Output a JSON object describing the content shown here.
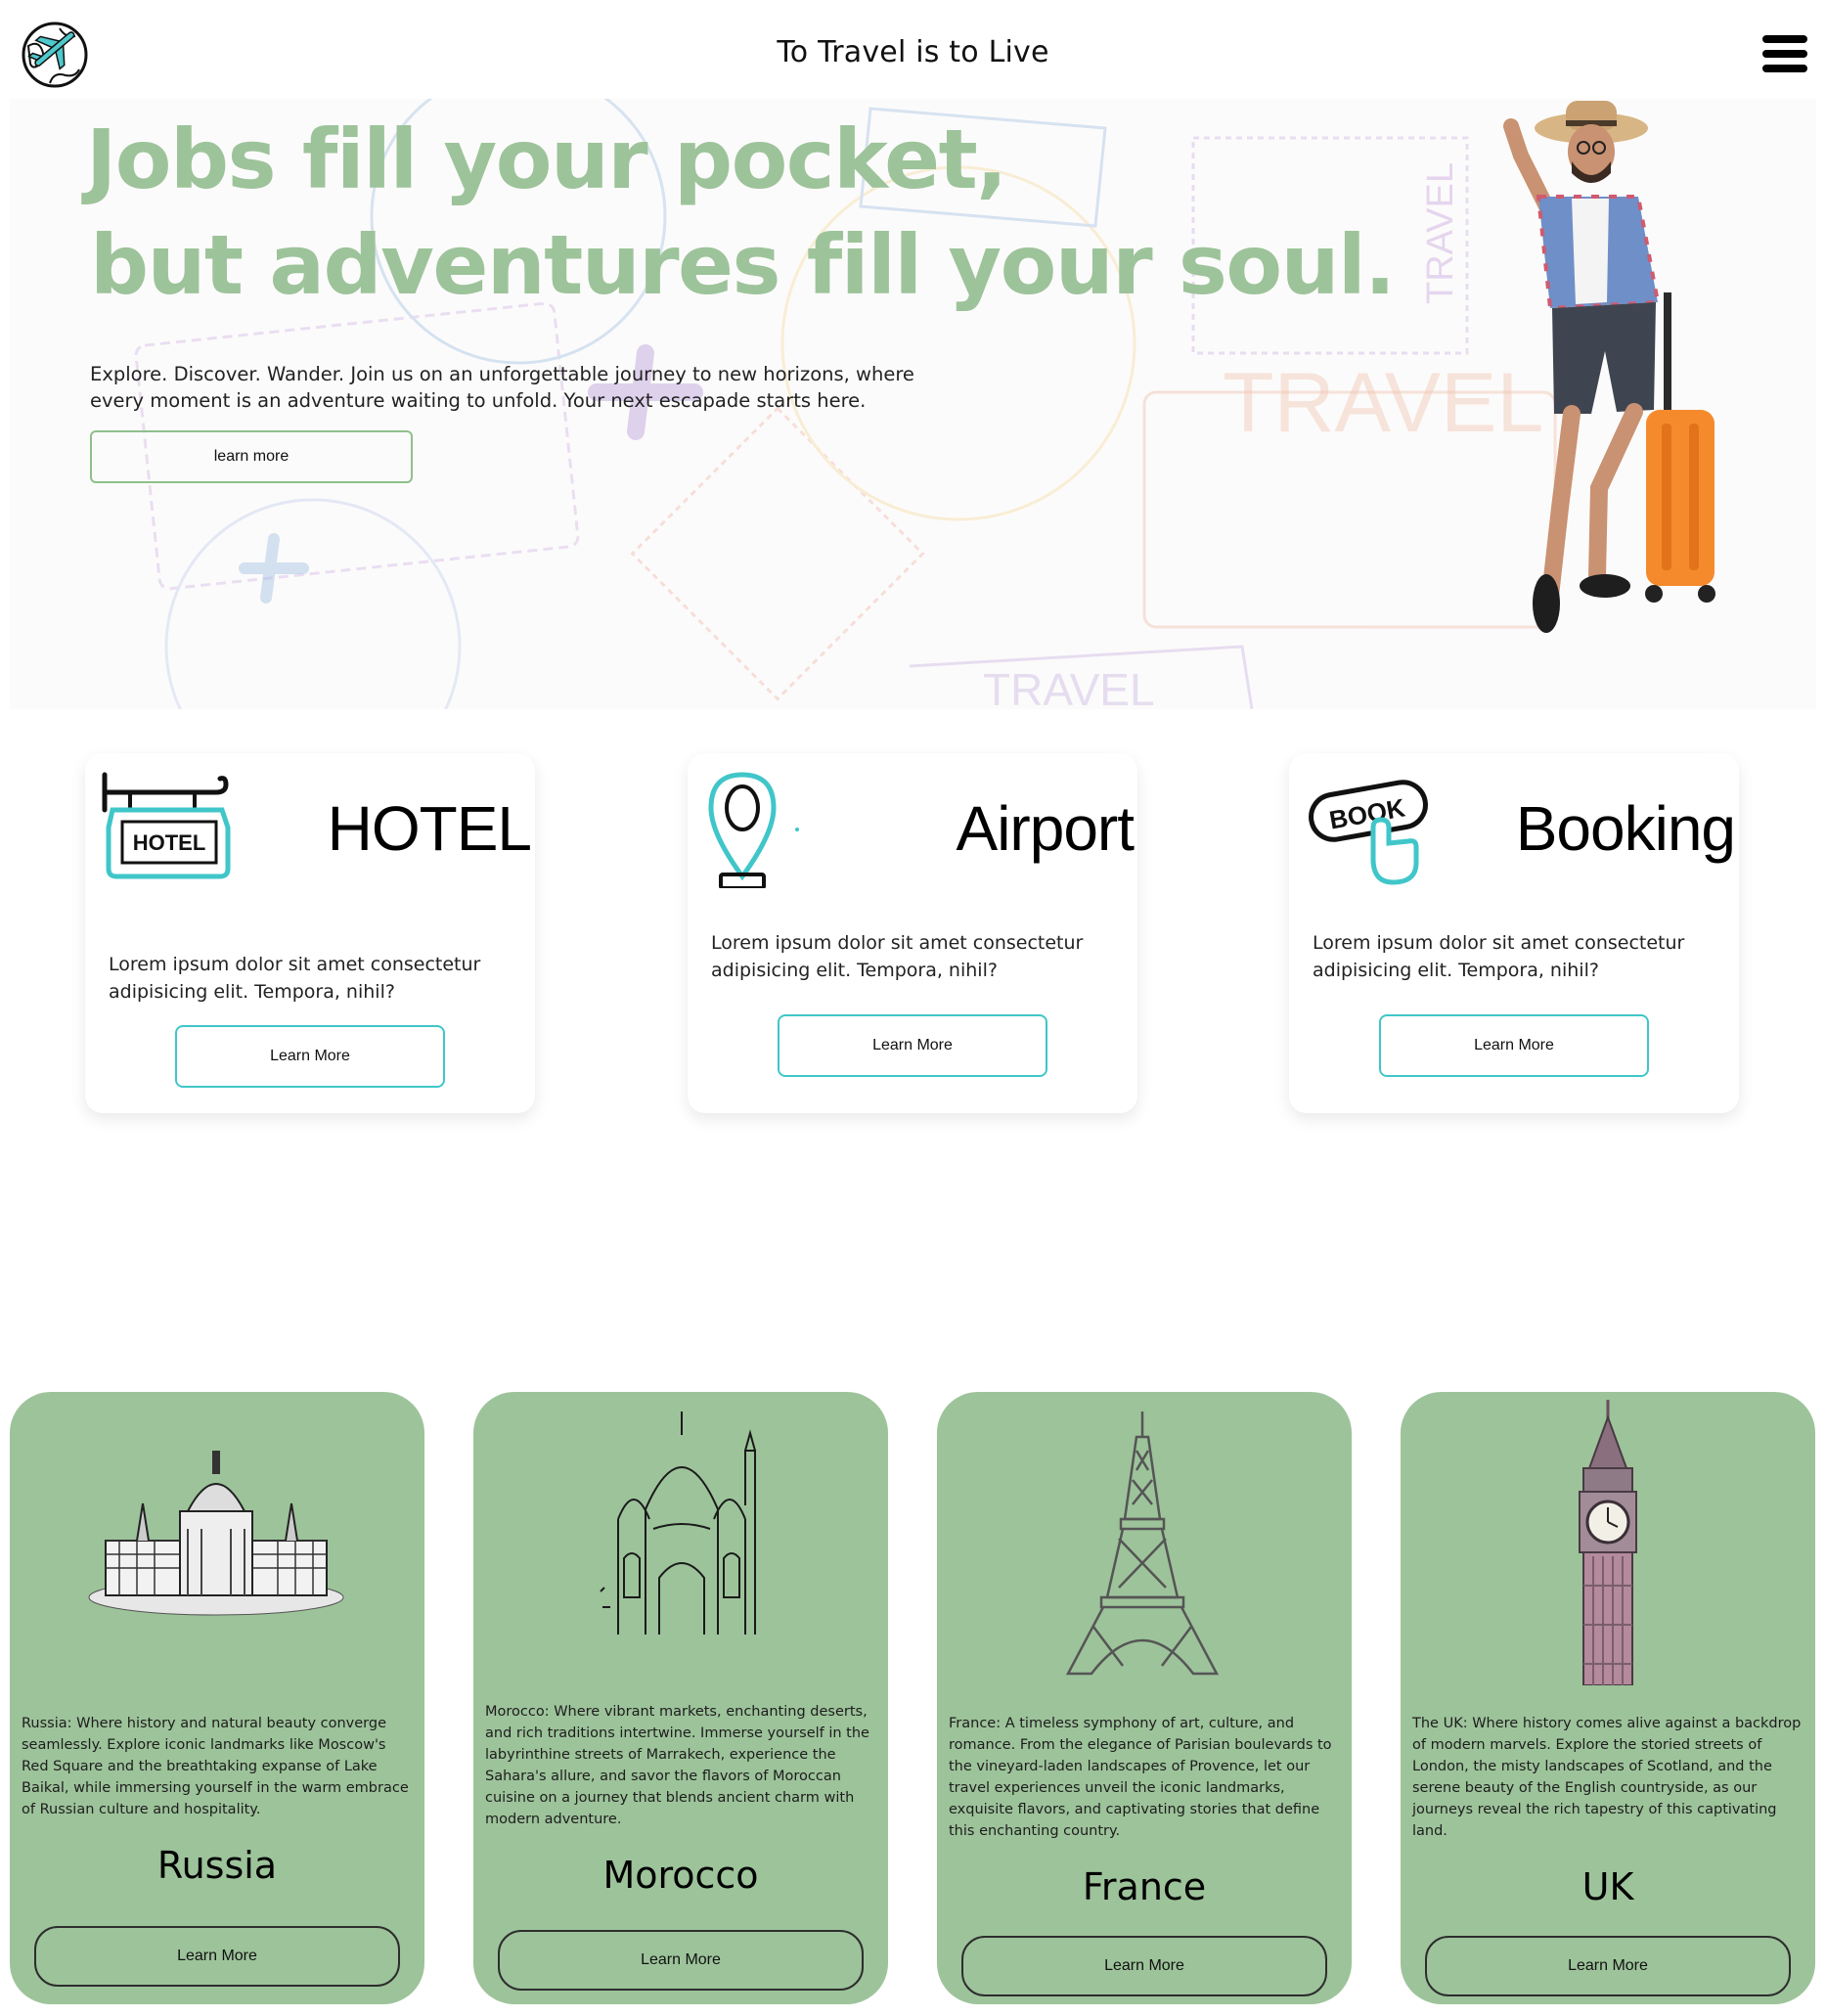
{
  "header": {
    "title": "To Travel is to Live",
    "logo_icon": "globe-plane-icon",
    "menu_icon": "hamburger-menu-icon"
  },
  "hero": {
    "title_line1": "Jobs fill your pocket,",
    "title_line2": "but adventures fill your soul.",
    "description": "Explore. Discover. Wander. Join us on an unforgettable journey to new horizons, where every moment is an adventure waiting to unfold. Your next escapade starts here.",
    "button_label": "learn more",
    "background_stamp_text": "TRAVEL",
    "accent_color": "#9dc39a"
  },
  "services": [
    {
      "title": "HOTEL",
      "icon": "hotel-sign-icon",
      "sign_text": "HOTEL",
      "text": "Lorem ipsum dolor sit amet consectetur adipisicing elit. Tempora, nihil?",
      "button_label": "Learn More"
    },
    {
      "title": "Airport",
      "icon": "location-pin-icon",
      "text": "Lorem ipsum dolor sit amet consectetur adipisicing elit. Tempora, nihil?",
      "button_label": "Learn More"
    },
    {
      "title": "Booking",
      "icon": "book-button-icon",
      "sign_text": "BOOK",
      "text": "Lorem ipsum dolor sit amet consectetur adipisicing elit. Tempora, nihil?",
      "button_label": "Learn More"
    }
  ],
  "services_accent_color": "#40c6c9",
  "countries": [
    {
      "name": "Russia",
      "landmark_icon": "cathedral-icon",
      "text": "Russia: Where history and natural beauty converge seamlessly. Explore iconic landmarks like Moscow's Red Square and the breathtaking expanse of Lake Baikal, while immersing yourself in the warm embrace of Russian culture and hospitality.",
      "button_label": "Learn More"
    },
    {
      "name": "Morocco",
      "landmark_icon": "mosque-icon",
      "text": "Morocco: Where vibrant markets, enchanting deserts, and rich traditions intertwine. Immerse yourself in the labyrinthine streets of Marrakech, experience the Sahara's allure, and savor the flavors of Moroccan cuisine on a journey that blends ancient charm with modern adventure.",
      "button_label": "Learn More"
    },
    {
      "name": "France",
      "landmark_icon": "eiffel-tower-icon",
      "text": "France: A timeless symphony of art, culture, and romance. From the elegance of Parisian boulevards to the vineyard-laden landscapes of Provence, let our travel experiences unveil the iconic landmarks, exquisite flavors, and captivating stories that define this enchanting country.",
      "button_label": "Learn More"
    },
    {
      "name": "UK",
      "landmark_icon": "big-ben-icon",
      "text": "The UK: Where history comes alive against a backdrop of modern marvels. Explore the storied streets of London, the misty landscapes of Scotland, and the serene beauty of the English countryside, as our journeys reveal the rich tapestry of this captivating land.",
      "button_label": "Learn More"
    }
  ],
  "country_card_color": "#9dc39a"
}
